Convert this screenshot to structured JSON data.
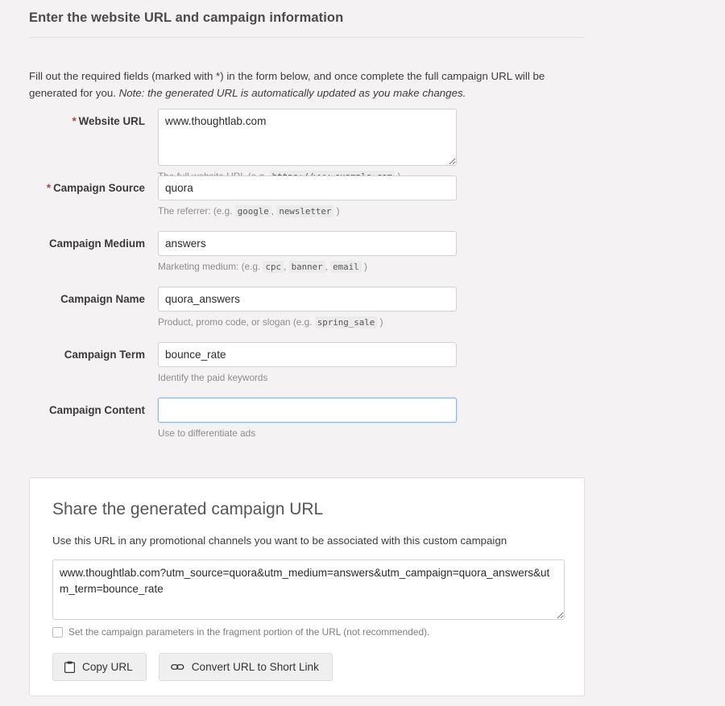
{
  "header": {
    "title": "Enter the website URL and campaign information",
    "intro_plain": "Fill out the required fields (marked with *) in the form below, and once complete the full campaign URL will be generated for you. ",
    "intro_italic": "Note: the generated URL is automatically updated as you make changes."
  },
  "form": {
    "required_marker": "*",
    "fields": {
      "website_url": {
        "label": "Website URL",
        "value": "www.thoughtlab.com",
        "help_before": "The full website URL (e.g.",
        "help_code_1": "https://www.example.com",
        "help_after": ")"
      },
      "campaign_source": {
        "label": "Campaign Source",
        "value": "quora",
        "help_before": "The referrer: (e.g.",
        "help_code_1": "google",
        "help_sep": ",",
        "help_code_2": "newsletter",
        "help_after": ")"
      },
      "campaign_medium": {
        "label": "Campaign Medium",
        "value": "answers",
        "help_before": "Marketing medium: (e.g.",
        "help_code_1": "cpc",
        "help_sep": ",",
        "help_code_2": "banner",
        "help_sep2": ",",
        "help_code_3": "email",
        "help_after": ")"
      },
      "campaign_name": {
        "label": "Campaign Name",
        "value": "quora_answers",
        "help_before": "Product, promo code, or slogan (e.g.",
        "help_code_1": "spring_sale",
        "help_after": ")"
      },
      "campaign_term": {
        "label": "Campaign Term",
        "value": "bounce_rate",
        "help_before": "Identify the paid keywords"
      },
      "campaign_content": {
        "label": "Campaign Content",
        "value": "",
        "help_before": "Use to differentiate ads"
      }
    }
  },
  "share_panel": {
    "title": "Share the generated campaign URL",
    "subtitle": "Use this URL in any promotional channels you want to be associated with this custom campaign",
    "generated_url": "www.thoughtlab.com?utm_source=quora&utm_medium=answers&utm_campaign=quora_answers&utm_term=bounce_rate",
    "fragment_checkbox_label": "Set the campaign parameters in the fragment portion of the URL (not recommended).",
    "fragment_checkbox_checked": false,
    "copy_button_label": "Copy URL",
    "convert_button_label": "Convert URL to Short Link"
  },
  "colors": {
    "page_background": "#f4f2f2",
    "required_asterisk": "#a94442",
    "focus_border": "#93b6d4",
    "panel_background": "#ffffff"
  }
}
